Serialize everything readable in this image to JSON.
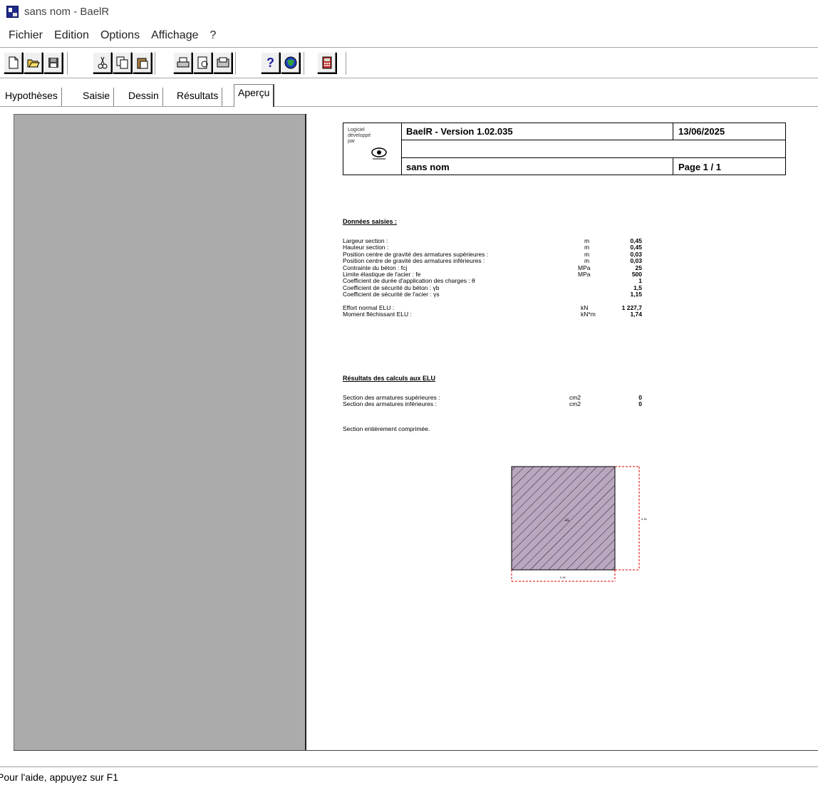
{
  "window": {
    "title": "sans nom - BaelR"
  },
  "menu": {
    "items": [
      "Fichier",
      "Edition",
      "Options",
      "Affichage",
      "?"
    ]
  },
  "toolbar": {
    "buttons": [
      "new-file-icon",
      "open-folder-icon",
      "save-disk-icon",
      "cut-icon",
      "copy-icon",
      "paste-icon",
      "print-icon",
      "print-preview-icon",
      "page-setup-icon",
      "help-icon",
      "web-icon",
      "calculator-icon"
    ]
  },
  "tabs": [
    "Hypothèses",
    "Saisie",
    "Dessin",
    "Résultats",
    "Aperçu"
  ],
  "active_tab": "Aperçu",
  "report": {
    "logo_text": "Logiciel\ndéveloppé\npar",
    "software": "BaelR - Version 1.02.035",
    "date": "13/06/2025",
    "doc_name": "sans nom",
    "page": "Page 1 / 1",
    "inputs_title": "Données saisies :",
    "inputs": [
      {
        "label": "Largeur section :",
        "value": "0,45",
        "unit": "m"
      },
      {
        "label": "Hauteur section :",
        "value": "0,45",
        "unit": "m"
      },
      {
        "label": "Position centre de gravité des armatures supérieures :",
        "value": "0,03",
        "unit": "m"
      },
      {
        "label": "Position centre de gravité des armatures inférieures :",
        "value": "0,03",
        "unit": "m"
      },
      {
        "label": "Contrainte du béton : fcj",
        "value": "25",
        "unit": "MPa"
      },
      {
        "label": "Limite élastique de l'acier : fe",
        "value": "500",
        "unit": "MPa"
      },
      {
        "label": "Coefficient de durée d'application des charges : θ",
        "value": "1",
        "unit": ""
      },
      {
        "label": "Coefficient de sécurité du béton : γb",
        "value": "1,5",
        "unit": ""
      },
      {
        "label": "Coefficient de sécurité de l'acier : γs",
        "value": "1,15",
        "unit": ""
      }
    ],
    "loads": [
      {
        "label": "Effort normal ELU :",
        "value": "1 227,7",
        "unit": "kN"
      },
      {
        "label": "Moment fléchissant ELU :",
        "value": "1,74",
        "unit": "kN*m"
      }
    ],
    "results_title": "Résultats des calculs aux ELU",
    "results": [
      {
        "label": "Section des armatures supérieures :",
        "value": "0",
        "unit": "cm2"
      },
      {
        "label": "Section des armatures inférieures :",
        "value": "0",
        "unit": "cm2"
      }
    ],
    "note": "Section entièrement comprimée.",
    "drawing": {
      "width_label": "0.45",
      "height_label": "0.45",
      "hatch_color": "#b9a6bf"
    }
  },
  "statusbar": {
    "text": "Pour l'aide, appuyez sur F1"
  }
}
